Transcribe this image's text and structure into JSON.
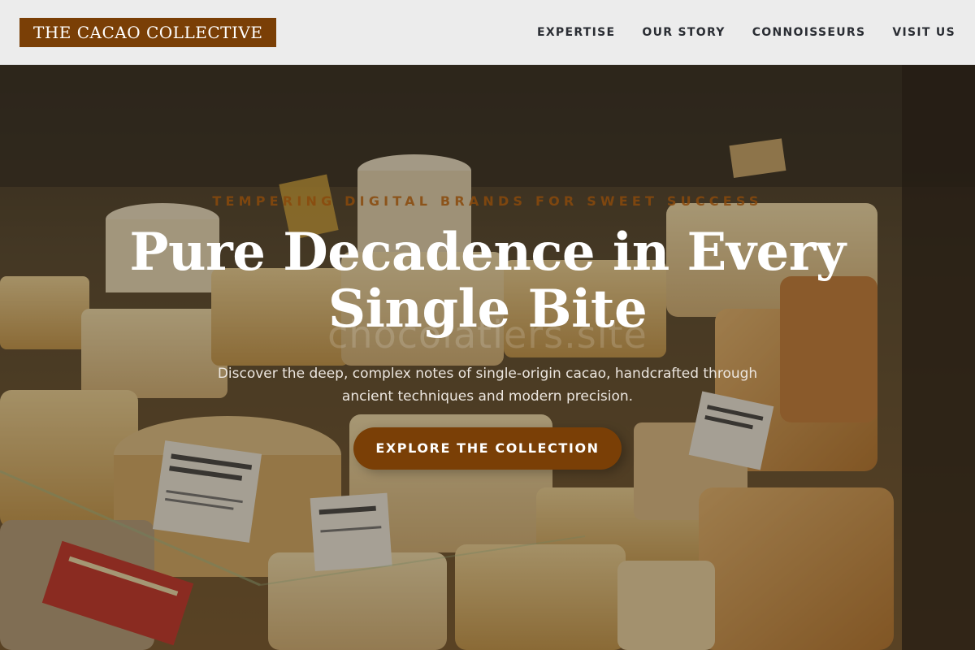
{
  "header": {
    "logo": "THE CACAO COLLECTIVE",
    "nav": [
      {
        "label": "EXPERTISE"
      },
      {
        "label": "OUR STORY"
      },
      {
        "label": "CONNOISSEURS"
      },
      {
        "label": "VISIT US"
      }
    ]
  },
  "hero": {
    "eyebrow": "TEMPERING DIGITAL BRANDS FOR SWEET SUCCESS",
    "title_line1": "Pure Decadence in Every",
    "title_line2": "Single Bite",
    "watermark": "chocolatiers.site",
    "subtitle": "Discover the deep, complex notes of single-origin cacao, handcrafted through ancient techniques and modern precision.",
    "cta_label": "EXPLORE THE COLLECTION"
  },
  "background": {
    "description_signs": [
      "E. GRAINDORGE FROMAGERIE",
      "LANGRES",
      "PONT L'ÉVÊQUE AOP",
      "BREBIROUSSE D'ARGENTAL"
    ]
  },
  "colors": {
    "brand": "#7a3f06",
    "header_bg": "#ececec",
    "nav_text": "#2a2d33",
    "title_text": "#ffffff"
  }
}
